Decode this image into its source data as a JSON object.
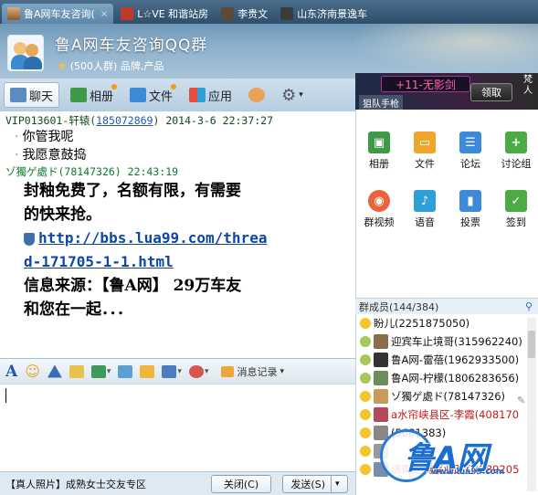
{
  "tabs": [
    {
      "label": "鲁A网车友咨询(",
      "active": true
    },
    {
      "label": "L☆VE 和谐站房",
      "active": false
    },
    {
      "label": "李贵文",
      "active": false
    },
    {
      "label": "山东济南景逸车",
      "active": false
    }
  ],
  "header": {
    "title": "鲁A网车友咨询QQ群",
    "subtitle": "(500人群) 品牌,产品"
  },
  "toolbar": {
    "chat": "聊天",
    "album": "相册",
    "file": "文件",
    "app": "应用"
  },
  "ad": {
    "pill": "+11-无影剑",
    "claim": "领取",
    "sub": "狙队手枪",
    "side": "梵人"
  },
  "chat": {
    "msg1_head": "VIP013601-轩辕(",
    "msg1_uid": "185072869",
    "msg1_time": ") 2014-3-6 22:37:27",
    "msg1_lines": [
      "你管我呢",
      "我愿意鼓捣"
    ],
    "msg2_head": "ゾ獨ゲ處ド(78147326)  22:43:19",
    "msg2_p1": "封釉免费了，名额有限，有需要",
    "msg2_p2": "的快来抢。",
    "msg2_link1": "http://bbs.lua99.com/threa",
    "msg2_link2": "d-171705-1-1.html",
    "msg2_p3": "信息来源：【鲁A网】 29万车友",
    "msg2_p4": "和您在一起．．．"
  },
  "input_toolbar": {
    "font": "A",
    "history": "消息记录"
  },
  "bottom": {
    "promo": "【真人照片】成熟女士交友专区",
    "close": "关闭(C)",
    "send": "发送(S)"
  },
  "apps": [
    "相册",
    "文件",
    "论坛",
    "讨论组",
    "群视频",
    "语音",
    "投票",
    "签到"
  ],
  "members": {
    "header": "群成员(144/384)",
    "list": [
      {
        "name": "盼儿(2251875050)",
        "red": false
      },
      {
        "name": "迎宾车止境哥(315962240)",
        "red": false
      },
      {
        "name": "鲁A网-雷蓓(1962933500)",
        "red": false
      },
      {
        "name": "鲁A网-柠檬(1806283656)",
        "red": false
      },
      {
        "name": "ゾ獨ゲ處ド(78147326)",
        "red": false
      },
      {
        "name": "a水帘峡县区-李霞(408170",
        "red": true
      },
      {
        "name": "(5681383)",
        "red": false
      },
      {
        "name": "",
        "red": false
      },
      {
        "name": "济南龙腾集业改灯(289205",
        "red": true
      }
    ]
  },
  "logo": {
    "text": "鲁A网",
    "url": "www.lua99.com"
  },
  "colors": {
    "accent": "#2356b3",
    "link": "#0e46a8",
    "header_top": "#6f97b8"
  }
}
